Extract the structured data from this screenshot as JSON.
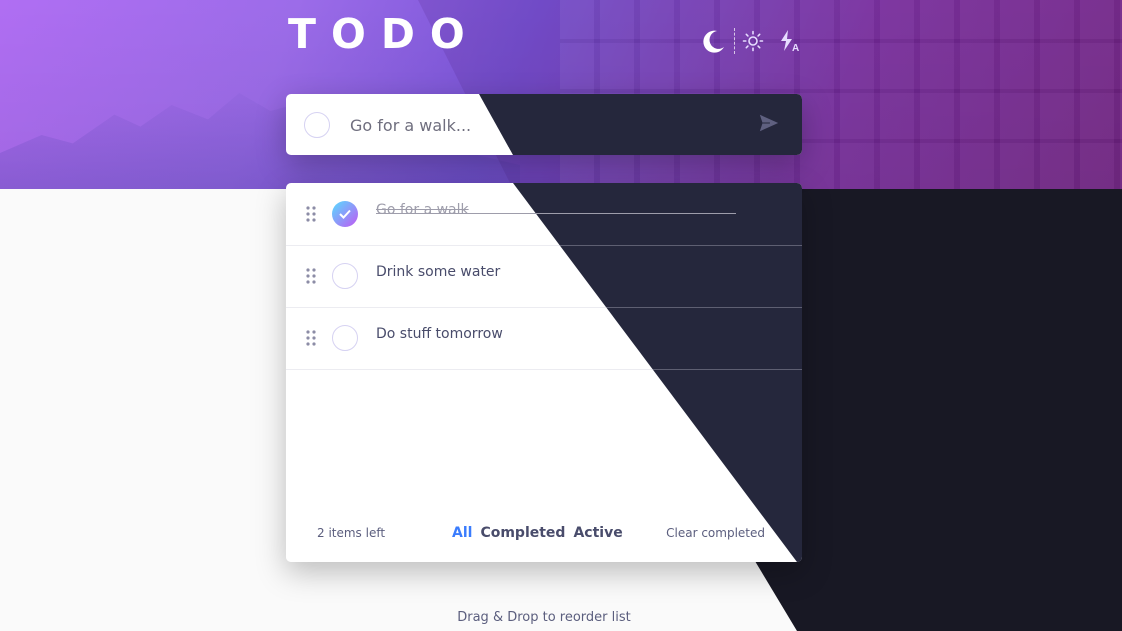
{
  "app": {
    "title": "TODO"
  },
  "theme": {
    "icons": [
      "moon-icon",
      "sun-icon",
      "auto-theme-icon"
    ]
  },
  "new_todo": {
    "placeholder": "Go for a walk..."
  },
  "todos": [
    {
      "text": "Go for a walk",
      "completed": true
    },
    {
      "text": "Drink some water",
      "completed": false
    },
    {
      "text": "Do stuff tomorrow",
      "completed": false
    }
  ],
  "footer": {
    "items_left": "2 items left",
    "filters": [
      "All",
      "Completed",
      "Active"
    ],
    "active_filter": "All",
    "clear_label": "Clear completed"
  },
  "hint": "Drag & Drop to reorder list",
  "colors": {
    "accent": "#3a7cfd",
    "check_gradient_start": "#57ddff",
    "check_gradient_end": "#c058f3",
    "dark_card": "#25273c",
    "dark_bg": "#181824"
  }
}
